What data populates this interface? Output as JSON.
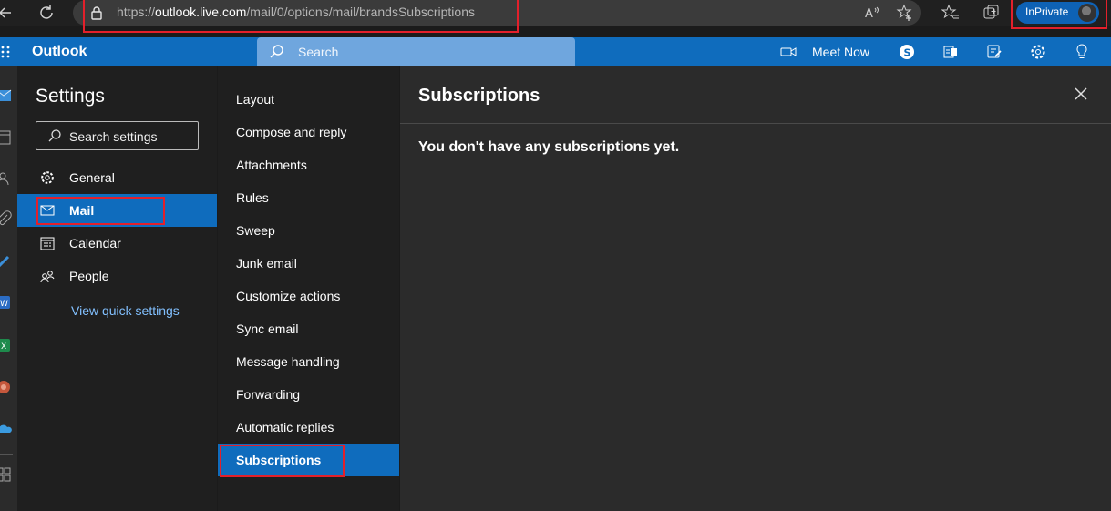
{
  "browser": {
    "url_prefix": "https://",
    "url_host": "outlook.live.com",
    "url_path": "/mail/0/options/mail/brandsSubscriptions",
    "inprivate_label": "InPrivate",
    "icons": [
      "back-icon",
      "refresh-icon",
      "lock-icon",
      "read-aloud-icon",
      "add-favorite-icon",
      "favorites-icon",
      "collections-icon",
      "profile-avatar"
    ]
  },
  "header": {
    "app_name": "Outlook",
    "search_placeholder": "Search",
    "meet_now_label": "Meet Now",
    "icons": [
      "waffle-icon",
      "search-icon",
      "video-icon",
      "skype-icon",
      "office-icon",
      "feedback-icon",
      "gear-icon",
      "lightbulb-icon"
    ]
  },
  "settings": {
    "title": "Settings",
    "search_placeholder": "Search settings",
    "nav": [
      {
        "label": "General",
        "icon": "gear-icon"
      },
      {
        "label": "Mail",
        "icon": "mail-icon",
        "active": true
      },
      {
        "label": "Calendar",
        "icon": "calendar-icon"
      },
      {
        "label": "People",
        "icon": "people-icon"
      }
    ],
    "quick_link": "View quick settings"
  },
  "mail_settings": {
    "items": [
      {
        "label": "Layout"
      },
      {
        "label": "Compose and reply"
      },
      {
        "label": "Attachments"
      },
      {
        "label": "Rules"
      },
      {
        "label": "Sweep"
      },
      {
        "label": "Junk email"
      },
      {
        "label": "Customize actions"
      },
      {
        "label": "Sync email"
      },
      {
        "label": "Message handling"
      },
      {
        "label": "Forwarding"
      },
      {
        "label": "Automatic replies"
      },
      {
        "label": "Subscriptions",
        "active": true
      }
    ]
  },
  "content": {
    "title": "Subscriptions",
    "message": "You don't have any subscriptions yet."
  },
  "colors": {
    "accent": "#0f6cbd",
    "highlight_box": "#e3202b",
    "link": "#82c0ff"
  }
}
